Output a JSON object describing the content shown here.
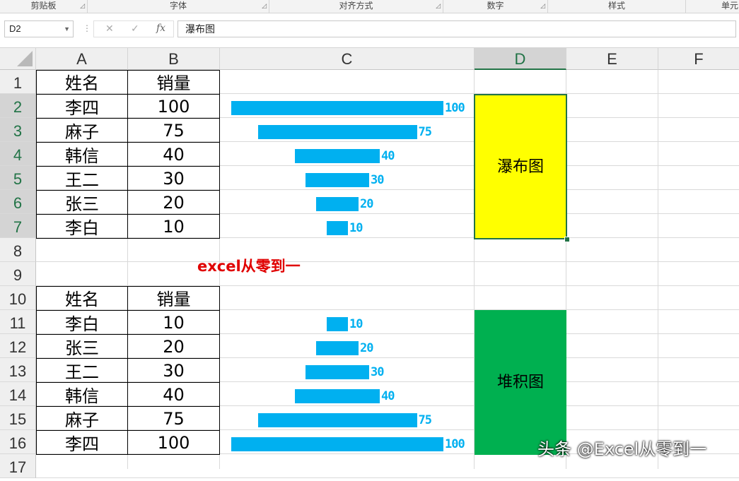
{
  "ribbon": {
    "groups": [
      "剪贴板",
      "字体",
      "对齐方式",
      "数字",
      "样式",
      "单元"
    ]
  },
  "formula_bar": {
    "name_box": "D2",
    "cancel_icon": "✕",
    "enter_icon": "✓",
    "fx_label": "fx",
    "content": "瀑布图"
  },
  "columns": [
    "A",
    "B",
    "C",
    "D",
    "E",
    "F"
  ],
  "rows": [
    "1",
    "2",
    "3",
    "4",
    "5",
    "6",
    "7",
    "8",
    "9",
    "10",
    "11",
    "12",
    "13",
    "14",
    "15",
    "16",
    "17"
  ],
  "table1": {
    "header": [
      "姓名",
      "销量"
    ],
    "rows": [
      {
        "name": "李四",
        "value": "100"
      },
      {
        "name": "麻子",
        "value": "75"
      },
      {
        "name": "韩信",
        "value": "40"
      },
      {
        "name": "王二",
        "value": "30"
      },
      {
        "name": "张三",
        "value": "20"
      },
      {
        "name": "李白",
        "value": "10"
      }
    ]
  },
  "table2": {
    "header": [
      "姓名",
      "销量"
    ],
    "rows": [
      {
        "name": "李白",
        "value": "10"
      },
      {
        "name": "张三",
        "value": "20"
      },
      {
        "name": "王二",
        "value": "30"
      },
      {
        "name": "韩信",
        "value": "40"
      },
      {
        "name": "麻子",
        "value": "75"
      },
      {
        "name": "李四",
        "value": "100"
      }
    ]
  },
  "bars1": [
    100,
    75,
    40,
    30,
    20,
    10
  ],
  "bars2": [
    10,
    20,
    30,
    40,
    75,
    100
  ],
  "label_waterfall": "瀑布图",
  "label_stacked": "堆积图",
  "note": "excel从零到一",
  "watermark": "头条 @Excel从零到一",
  "colors": {
    "bar": "#00b0f0",
    "waterfall_box": "#ffff00",
    "stacked_box": "#00b050",
    "note": "#e00000",
    "selection": "#217346"
  }
}
